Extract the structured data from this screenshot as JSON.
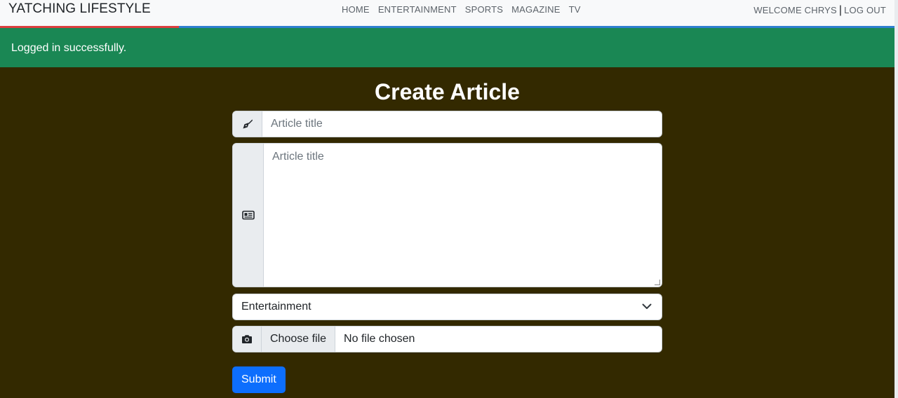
{
  "navbar": {
    "brand": "YATCHING LIFESTYLE",
    "links": [
      "HOME",
      "ENTERTAINMENT",
      "SPORTS",
      "MAGAZINE",
      "TV"
    ],
    "welcome": "WELCOME CHRYS",
    "separator": "|",
    "logout": "LOG OUT"
  },
  "alert": {
    "message": "Logged in successfully.",
    "color": "#1a8754"
  },
  "page": {
    "title": "Create Article"
  },
  "form": {
    "title_placeholder": "Article title",
    "title_icon": "pen-nib-icon",
    "body_placeholder": "Article title",
    "body_icon": "newspaper-icon",
    "category_selected": "Entertainment",
    "image_icon": "camera-icon",
    "choose_file_label": "Choose file",
    "file_status": "No file chosen",
    "submit_label": "Submit"
  },
  "colors": {
    "background": "#332900",
    "primary": "#0d6efd",
    "nav_accent": "#2f7fd0",
    "nav_accent_red": "#dc3f3f"
  }
}
